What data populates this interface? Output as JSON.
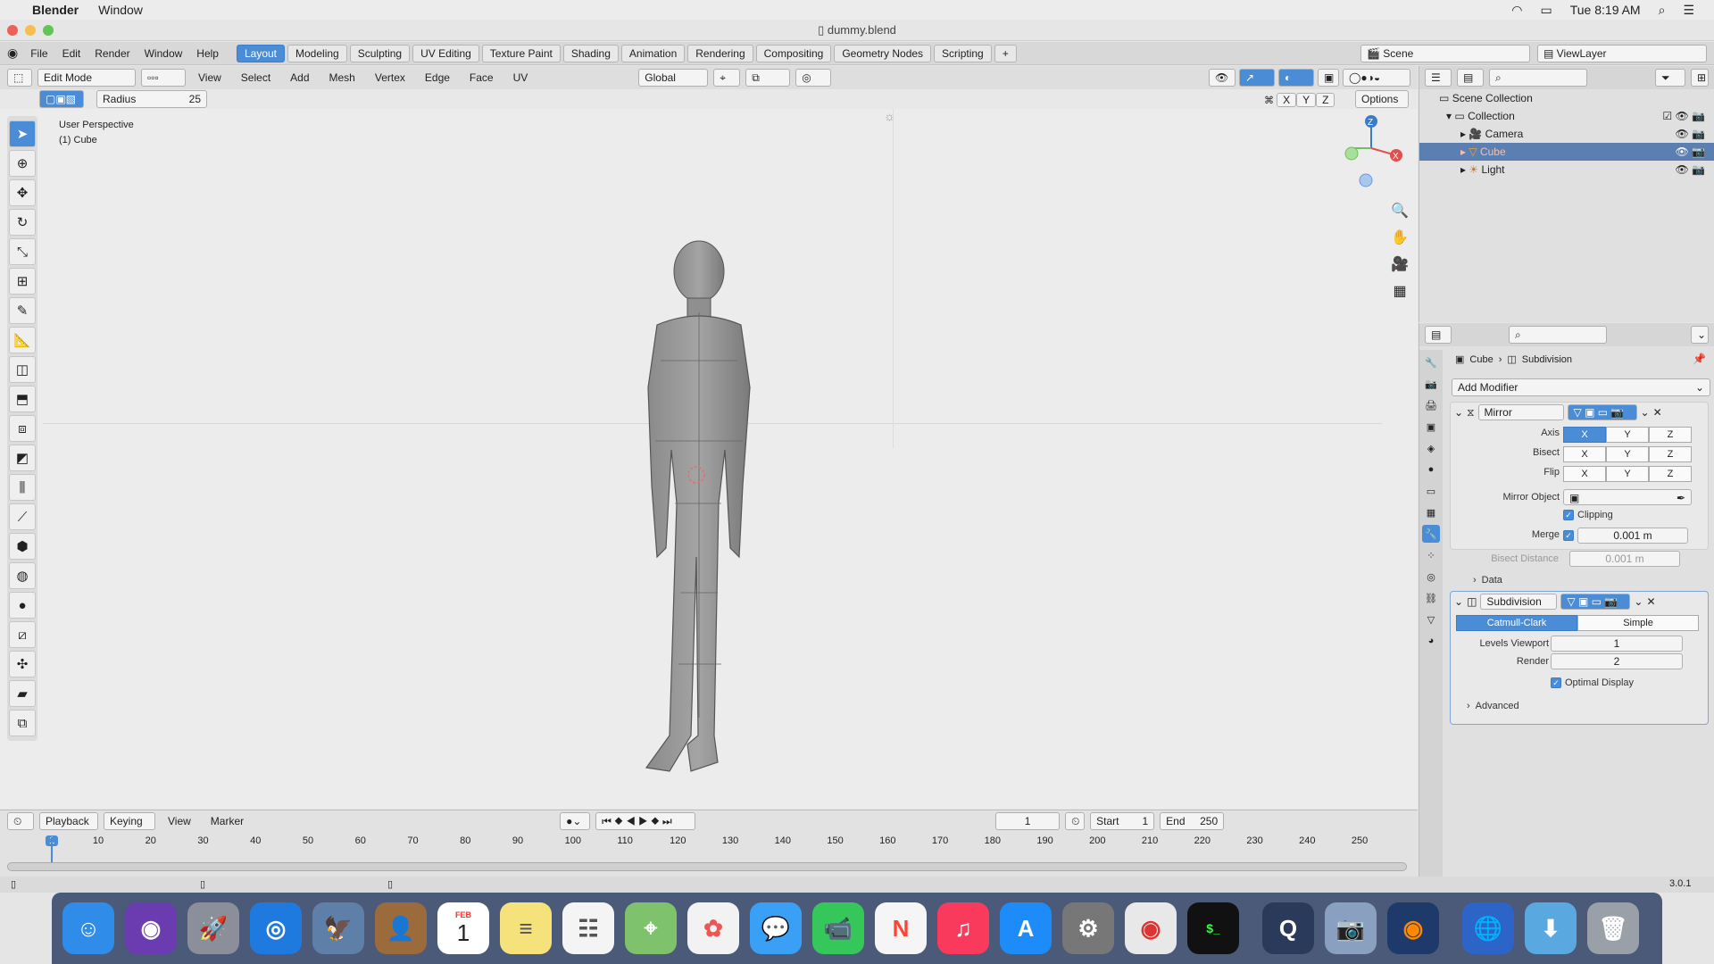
{
  "menubar": {
    "app": "Blender",
    "window": "Window",
    "datetime": "Tue 8:19 AM"
  },
  "title": "dummy.blend",
  "topmenu": [
    "File",
    "Edit",
    "Render",
    "Window",
    "Help"
  ],
  "workspaces": [
    "Layout",
    "Modeling",
    "Sculpting",
    "UV Editing",
    "Texture Paint",
    "Shading",
    "Animation",
    "Rendering",
    "Compositing",
    "Geometry Nodes",
    "Scripting"
  ],
  "active_workspace": "Layout",
  "scene": "Scene",
  "viewlayer": "ViewLayer",
  "viewport": {
    "mode": "Edit Mode",
    "menus": [
      "View",
      "Select",
      "Add",
      "Mesh",
      "Vertex",
      "Edge",
      "Face",
      "UV"
    ],
    "orientation": "Global",
    "radius_label": "Radius",
    "radius_value": "25",
    "options": "Options",
    "axes": [
      "X",
      "Y",
      "Z"
    ],
    "overlay_line1": "User Perspective",
    "overlay_line2": "(1) Cube",
    "gizmo": {
      "z": "Z",
      "x": "X"
    }
  },
  "outliner": {
    "root": "Scene Collection",
    "collection": "Collection",
    "items": [
      "Camera",
      "Cube",
      "Light"
    ]
  },
  "properties": {
    "breadcrumb": {
      "object": "Cube",
      "modifier": "Subdivision"
    },
    "add_modifier": "Add Modifier",
    "mirror": {
      "name": "Mirror",
      "axis_label": "Axis",
      "bisect_label": "Bisect",
      "flip_label": "Flip",
      "xyz": [
        "X",
        "Y",
        "Z"
      ],
      "mirror_object_label": "Mirror Object",
      "clipping_label": "Clipping",
      "merge_label": "Merge",
      "merge_value": "0.001 m",
      "bisect_distance_label": "Bisect Distance",
      "bisect_distance_value": "0.001 m",
      "data_label": "Data"
    },
    "subdivision": {
      "name": "Subdivision",
      "catmull": "Catmull-Clark",
      "simple": "Simple",
      "levels_label": "Levels Viewport",
      "levels_value": "1",
      "render_label": "Render",
      "render_value": "2",
      "optimal_label": "Optimal Display",
      "advanced_label": "Advanced"
    }
  },
  "timeline": {
    "menus": [
      "Playback",
      "Keying",
      "View",
      "Marker"
    ],
    "current_frame": "1",
    "start_label": "Start",
    "start_value": "1",
    "end_label": "End",
    "end_value": "250",
    "ticks": [
      "1",
      "10",
      "20",
      "30",
      "40",
      "50",
      "60",
      "70",
      "80",
      "90",
      "100",
      "110",
      "120",
      "130",
      "140",
      "150",
      "160",
      "170",
      "180",
      "190",
      "200",
      "210",
      "220",
      "230",
      "240",
      "250"
    ]
  },
  "status": {
    "version": "3.0.1"
  },
  "dock": [
    "Finder",
    "Siri",
    "Launchpad",
    "Safari",
    "Preview",
    "Contacts",
    "Calendar",
    "Notes",
    "Reminders",
    "Maps",
    "Photos",
    "Messages",
    "FaceTime",
    "News",
    "Music",
    "App Store",
    "System Preferences",
    "Chrome",
    "Terminal",
    "QuickTime",
    "Image Capture",
    "Blender",
    "Network",
    "Downloads",
    "Trash"
  ],
  "calendar": {
    "month": "FEB",
    "day": "1"
  },
  "colors": {
    "accent": "#4a8cd6",
    "viewport_bg": "#ececec"
  }
}
